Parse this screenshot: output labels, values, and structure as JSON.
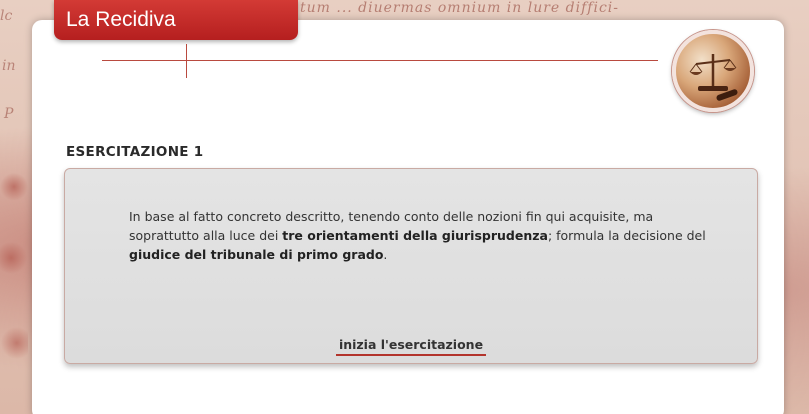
{
  "background": {
    "script_text": "tum ... diuermas omnium in lure diffici-",
    "margin_texts": [
      "lc",
      "in",
      "P"
    ]
  },
  "header": {
    "title": "La Recidiva",
    "emblem_icon": "scales-of-justice-icon"
  },
  "exercise": {
    "heading": "ESERCITAZIONE 1",
    "text_parts": {
      "p1": "In base al fatto concreto descritto, tenendo conto delle nozioni fin qui acquisite, ma soprattutto alla luce dei ",
      "b1": "tre orientamenti della giurisprudenza",
      "p2": "; formula la decisione del ",
      "b2": "giudice del tribunale di primo grado",
      "p3": "."
    },
    "start_label": "inizia l'esercitazione"
  },
  "colors": {
    "accent_red": "#c0282a",
    "line_red": "#b94a3f",
    "box_gray": "#e0e0e0"
  }
}
